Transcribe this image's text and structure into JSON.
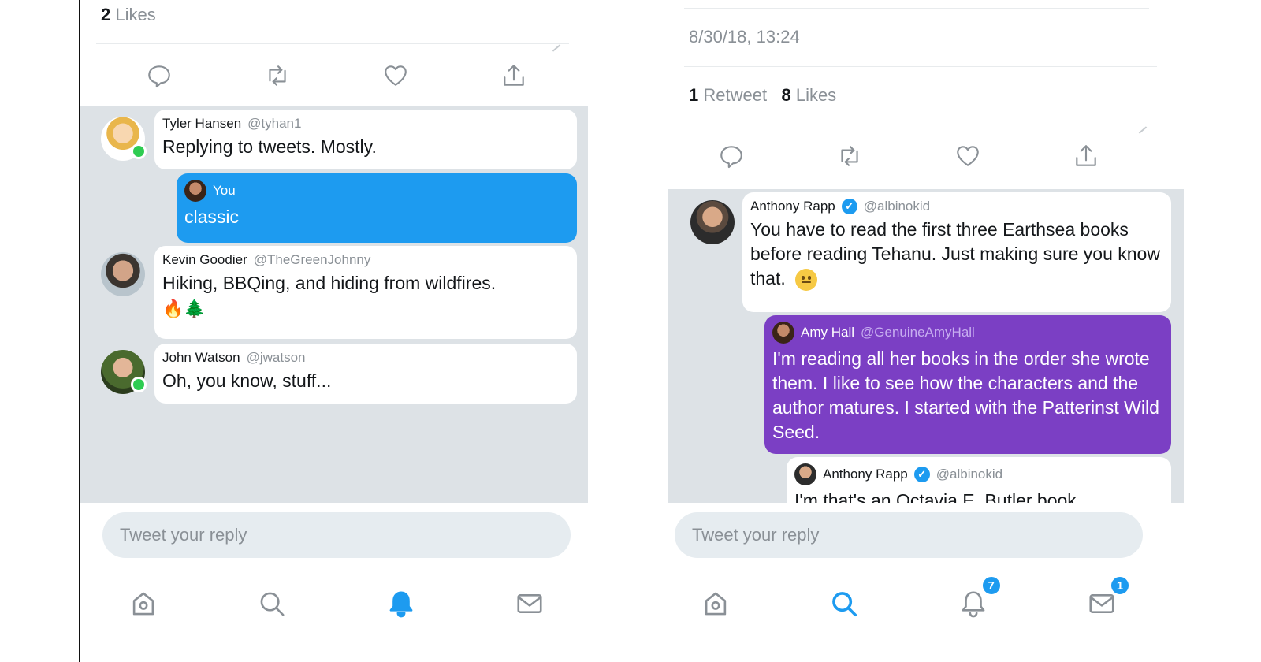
{
  "left": {
    "likes_count": "2",
    "likes_label": "Likes",
    "replies": [
      {
        "name": "Tyler Hansen",
        "handle": "@tyhan1",
        "text": "Replying to tweets. Mostly."
      },
      {
        "name": "You",
        "text": "classic"
      },
      {
        "name": "Kevin Goodier",
        "handle": "@TheGreenJohnny",
        "text": "Hiking, BBQing, and hiding from wildfires.",
        "emoji": "🔥🌲"
      },
      {
        "name": "John Watson",
        "handle": "@jwatson",
        "text": "Oh, you know, stuff..."
      }
    ],
    "reply_placeholder": "Tweet your reply"
  },
  "right": {
    "timestamp": "8/30/18, 13:24",
    "retweets_count": "1",
    "retweets_label": "Retweet",
    "likes_count": "8",
    "likes_label": "Likes",
    "replies": [
      {
        "name": "Anthony Rapp",
        "handle": "@albinokid",
        "text": "You have to read the first three Earthsea books before reading Tehanu. Just making sure you know that."
      },
      {
        "name": "Amy Hall",
        "handle": "@GenuineAmyHall",
        "text": "I'm reading all her books in the order she wrote them.  I like to see how the characters and the author matures.  I started with the Patterinst Wild Seed."
      },
      {
        "name": "Anthony Rapp",
        "handle": "@albinokid",
        "text": "I'm that's an Octavia E. Butler book"
      }
    ],
    "reply_placeholder": "Tweet your reply",
    "badges": {
      "notifications": "7",
      "messages": "1"
    }
  },
  "icons": {
    "actions": [
      "reply-icon",
      "retweet-icon",
      "like-icon",
      "share-icon"
    ],
    "tabs": [
      "home-icon",
      "search-icon",
      "notifications-icon",
      "messages-icon"
    ]
  },
  "colors": {
    "accent": "#1d9bf0",
    "purple_bubble": "#7b3fc4",
    "thread_bg": "#dde2e6",
    "online": "#2ecc51"
  }
}
